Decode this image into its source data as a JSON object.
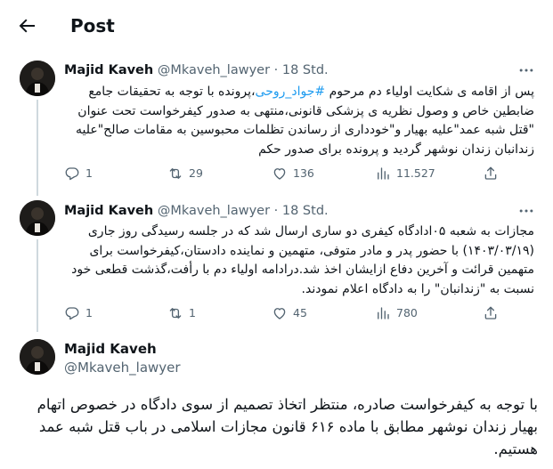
{
  "header": {
    "title": "Post"
  },
  "tweets": [
    {
      "name": "Majid Kaveh",
      "handle": "@Mkaveh_lawyer",
      "dot": "·",
      "time": "18 Std.",
      "text_before": "پس از اقامه ی شکایت اولیاء دم مرحوم ",
      "hashtag": "#جواد_روحی",
      "text_after": "،پرونده با توجه به تحقیقات جامع ضابطین خاص و وصول نظریه ی پزشکی قانونی،منتهی به صدور کیفرخواست تحت عنوان \"قتل شبه عمد\"علیه بهیار و\"خودداری از رساندن تظلمات محبوسین به مقامات صالح\"علیه زندانبان زندان نوشهر گردید و پرونده برای صدور حکم",
      "replies": "1",
      "retweets": "29",
      "likes": "136",
      "views": "11.527"
    },
    {
      "name": "Majid Kaveh",
      "handle": "@Mkaveh_lawyer",
      "dot": "·",
      "time": "18 Std.",
      "text": "مجازات به شعبه ۰۵ادادگاه کیفری دو ساری ارسال شد که در جلسه رسیدگی روز جاری (۱۴۰۳/۰۳/۱۹) با حضور پدر و مادر متوفی، متهمین و نماینده دادستان،کیفرخواست برای متهمین قرائت و آخرین دفاع ازایشان اخذ شد.درادامه اولیاء دم با رأفت،گذشت قطعی خود نسبت به \"زندانبان\" را به دادگاه اعلام نمودند.",
      "replies": "1",
      "retweets": "1",
      "likes": "45",
      "views": "780"
    }
  ],
  "main_tweet": {
    "name": "Majid Kaveh",
    "handle": "@Mkaveh_lawyer",
    "text": "با توجه به کیفرخواست صادره، منتظر اتخاذ تصمیم از سوی دادگاه در خصوص اتهام بهیار زندان نوشهر مطابق با ماده ۶۱۶ قانون مجازات اسلامی در باب قتل شبه عمد هستیم."
  },
  "icons": {
    "back": "arrow-left-icon",
    "more": "more-dots-icon",
    "reply": "reply-icon",
    "retweet": "retweet-icon",
    "like": "heart-icon",
    "views": "views-chart-icon",
    "share": "share-icon"
  },
  "colors": {
    "accent": "#1d9bf0",
    "muted": "#536471",
    "text": "#0f1419",
    "line": "#cfd9de"
  }
}
